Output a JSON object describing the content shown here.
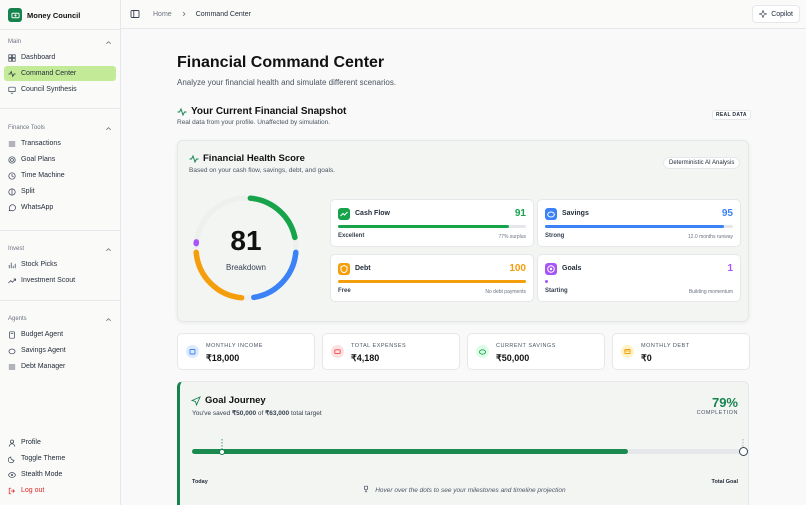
{
  "app": {
    "name": "Money Council"
  },
  "sidebar": {
    "sections": [
      {
        "title": "Main",
        "items": [
          {
            "label": "Dashboard",
            "icon": "dashboard-icon"
          },
          {
            "label": "Command Center",
            "icon": "activity-icon",
            "active": true
          },
          {
            "label": "Council Synthesis",
            "icon": "monitor-icon"
          }
        ]
      },
      {
        "title": "Finance Tools",
        "items": [
          {
            "label": "Transactions",
            "icon": "list-icon"
          },
          {
            "label": "Goal Plans",
            "icon": "target-icon"
          },
          {
            "label": "Time Machine",
            "icon": "clock-icon"
          },
          {
            "label": "Split",
            "icon": "split-icon"
          },
          {
            "label": "WhatsApp",
            "icon": "chat-icon"
          }
        ]
      },
      {
        "title": "Invest",
        "items": [
          {
            "label": "Stock Picks",
            "icon": "chart-icon"
          },
          {
            "label": "Investment Scout",
            "icon": "trend-icon"
          }
        ]
      },
      {
        "title": "Agents",
        "items": [
          {
            "label": "Budget Agent",
            "icon": "calculator-icon"
          },
          {
            "label": "Savings Agent",
            "icon": "piggy-icon"
          },
          {
            "label": "Debt Manager",
            "icon": "list-icon"
          }
        ]
      }
    ],
    "footer": [
      {
        "label": "Profile",
        "icon": "user-icon"
      },
      {
        "label": "Toggle Theme",
        "icon": "moon-icon"
      },
      {
        "label": "Stealth Mode",
        "icon": "eye-icon"
      },
      {
        "label": "Log out",
        "icon": "logout-icon"
      }
    ]
  },
  "breadcrumb": {
    "home": "Home",
    "current": "Command Center"
  },
  "copilot_label": "Copilot",
  "page": {
    "title": "Financial Command Center",
    "subtitle": "Analyze your financial health and simulate different scenarios."
  },
  "snapshot": {
    "title": "Your Current Financial Snapshot",
    "subtitle": "Real data from your profile. Unaffected by simulation.",
    "badge": "REAL DATA"
  },
  "health": {
    "title": "Financial Health Score",
    "subtitle": "Based on your cash flow, savings, debt, and goals.",
    "badge": "Deterministic AI Analysis",
    "score": "81",
    "score_label": "Breakdown",
    "metrics": [
      {
        "name": "Cash Flow",
        "value": "91",
        "level": 0.91,
        "status": "Excellent",
        "note": "77% surplus",
        "color": "#16a34a"
      },
      {
        "name": "Savings",
        "value": "95",
        "level": 0.95,
        "status": "Strong",
        "note": "12.0 months runway",
        "color": "#3b82f6"
      },
      {
        "name": "Debt",
        "value": "100",
        "level": 1.0,
        "status": "Free",
        "note": "No debt payments",
        "color": "#f59e0b"
      },
      {
        "name": "Goals",
        "value": "1",
        "level": 0.01,
        "status": "Starting",
        "note": "Building momentum",
        "color": "#a855f7"
      }
    ]
  },
  "stats": [
    {
      "label": "MONTHLY INCOME",
      "value": "₹18,000",
      "color": "#3b82f6",
      "bg": "#dbeafe"
    },
    {
      "label": "TOTAL EXPENSES",
      "value": "₹4,180",
      "color": "#ef4444",
      "bg": "#fee2e2"
    },
    {
      "label": "CURRENT SAVINGS",
      "value": "₹50,000",
      "color": "#16a34a",
      "bg": "#dcfce7"
    },
    {
      "label": "MONTHLY DEBT",
      "value": "₹0",
      "color": "#f59e0b",
      "bg": "#fef3c7"
    }
  ],
  "goal": {
    "title": "Goal Journey",
    "saved_prefix": "You've saved",
    "saved": "₹50,000",
    "of": "of",
    "target": "₹63,000",
    "target_suffix": "total target",
    "percent": "79%",
    "percent_label": "COMPLETION",
    "progress": 0.79,
    "start_label": "Today",
    "end_label": "Total Goal",
    "hint": "Hover over the dots to see your milestones and timeline projection"
  }
}
